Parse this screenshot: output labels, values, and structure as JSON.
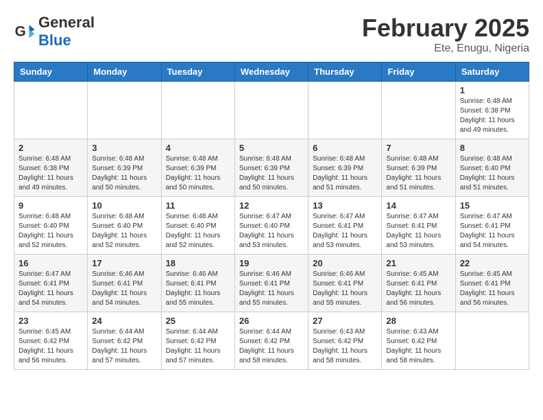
{
  "header": {
    "logo_general": "General",
    "logo_blue": "Blue",
    "month_title": "February 2025",
    "location": "Ete, Enugu, Nigeria"
  },
  "days_of_week": [
    "Sunday",
    "Monday",
    "Tuesday",
    "Wednesday",
    "Thursday",
    "Friday",
    "Saturday"
  ],
  "weeks": [
    [
      {
        "day": "",
        "info": ""
      },
      {
        "day": "",
        "info": ""
      },
      {
        "day": "",
        "info": ""
      },
      {
        "day": "",
        "info": ""
      },
      {
        "day": "",
        "info": ""
      },
      {
        "day": "",
        "info": ""
      },
      {
        "day": "1",
        "info": "Sunrise: 6:48 AM\nSunset: 6:38 PM\nDaylight: 11 hours\nand 49 minutes."
      }
    ],
    [
      {
        "day": "2",
        "info": "Sunrise: 6:48 AM\nSunset: 6:38 PM\nDaylight: 11 hours\nand 49 minutes."
      },
      {
        "day": "3",
        "info": "Sunrise: 6:48 AM\nSunset: 6:39 PM\nDaylight: 11 hours\nand 50 minutes."
      },
      {
        "day": "4",
        "info": "Sunrise: 6:48 AM\nSunset: 6:39 PM\nDaylight: 11 hours\nand 50 minutes."
      },
      {
        "day": "5",
        "info": "Sunrise: 6:48 AM\nSunset: 6:39 PM\nDaylight: 11 hours\nand 50 minutes."
      },
      {
        "day": "6",
        "info": "Sunrise: 6:48 AM\nSunset: 6:39 PM\nDaylight: 11 hours\nand 51 minutes."
      },
      {
        "day": "7",
        "info": "Sunrise: 6:48 AM\nSunset: 6:39 PM\nDaylight: 11 hours\nand 51 minutes."
      },
      {
        "day": "8",
        "info": "Sunrise: 6:48 AM\nSunset: 6:40 PM\nDaylight: 11 hours\nand 51 minutes."
      }
    ],
    [
      {
        "day": "9",
        "info": "Sunrise: 6:48 AM\nSunset: 6:40 PM\nDaylight: 11 hours\nand 52 minutes."
      },
      {
        "day": "10",
        "info": "Sunrise: 6:48 AM\nSunset: 6:40 PM\nDaylight: 11 hours\nand 52 minutes."
      },
      {
        "day": "11",
        "info": "Sunrise: 6:48 AM\nSunset: 6:40 PM\nDaylight: 11 hours\nand 52 minutes."
      },
      {
        "day": "12",
        "info": "Sunrise: 6:47 AM\nSunset: 6:40 PM\nDaylight: 11 hours\nand 53 minutes."
      },
      {
        "day": "13",
        "info": "Sunrise: 6:47 AM\nSunset: 6:41 PM\nDaylight: 11 hours\nand 53 minutes."
      },
      {
        "day": "14",
        "info": "Sunrise: 6:47 AM\nSunset: 6:41 PM\nDaylight: 11 hours\nand 53 minutes."
      },
      {
        "day": "15",
        "info": "Sunrise: 6:47 AM\nSunset: 6:41 PM\nDaylight: 11 hours\nand 54 minutes."
      }
    ],
    [
      {
        "day": "16",
        "info": "Sunrise: 6:47 AM\nSunset: 6:41 PM\nDaylight: 11 hours\nand 54 minutes."
      },
      {
        "day": "17",
        "info": "Sunrise: 6:46 AM\nSunset: 6:41 PM\nDaylight: 11 hours\nand 54 minutes."
      },
      {
        "day": "18",
        "info": "Sunrise: 6:46 AM\nSunset: 6:41 PM\nDaylight: 11 hours\nand 55 minutes."
      },
      {
        "day": "19",
        "info": "Sunrise: 6:46 AM\nSunset: 6:41 PM\nDaylight: 11 hours\nand 55 minutes."
      },
      {
        "day": "20",
        "info": "Sunrise: 6:46 AM\nSunset: 6:41 PM\nDaylight: 11 hours\nand 55 minutes."
      },
      {
        "day": "21",
        "info": "Sunrise: 6:45 AM\nSunset: 6:41 PM\nDaylight: 11 hours\nand 56 minutes."
      },
      {
        "day": "22",
        "info": "Sunrise: 6:45 AM\nSunset: 6:41 PM\nDaylight: 11 hours\nand 56 minutes."
      }
    ],
    [
      {
        "day": "23",
        "info": "Sunrise: 6:45 AM\nSunset: 6:42 PM\nDaylight: 11 hours\nand 56 minutes."
      },
      {
        "day": "24",
        "info": "Sunrise: 6:44 AM\nSunset: 6:42 PM\nDaylight: 11 hours\nand 57 minutes."
      },
      {
        "day": "25",
        "info": "Sunrise: 6:44 AM\nSunset: 6:42 PM\nDaylight: 11 hours\nand 57 minutes."
      },
      {
        "day": "26",
        "info": "Sunrise: 6:44 AM\nSunset: 6:42 PM\nDaylight: 11 hours\nand 58 minutes."
      },
      {
        "day": "27",
        "info": "Sunrise: 6:43 AM\nSunset: 6:42 PM\nDaylight: 11 hours\nand 58 minutes."
      },
      {
        "day": "28",
        "info": "Sunrise: 6:43 AM\nSunset: 6:42 PM\nDaylight: 11 hours\nand 58 minutes."
      },
      {
        "day": "",
        "info": ""
      }
    ]
  ]
}
